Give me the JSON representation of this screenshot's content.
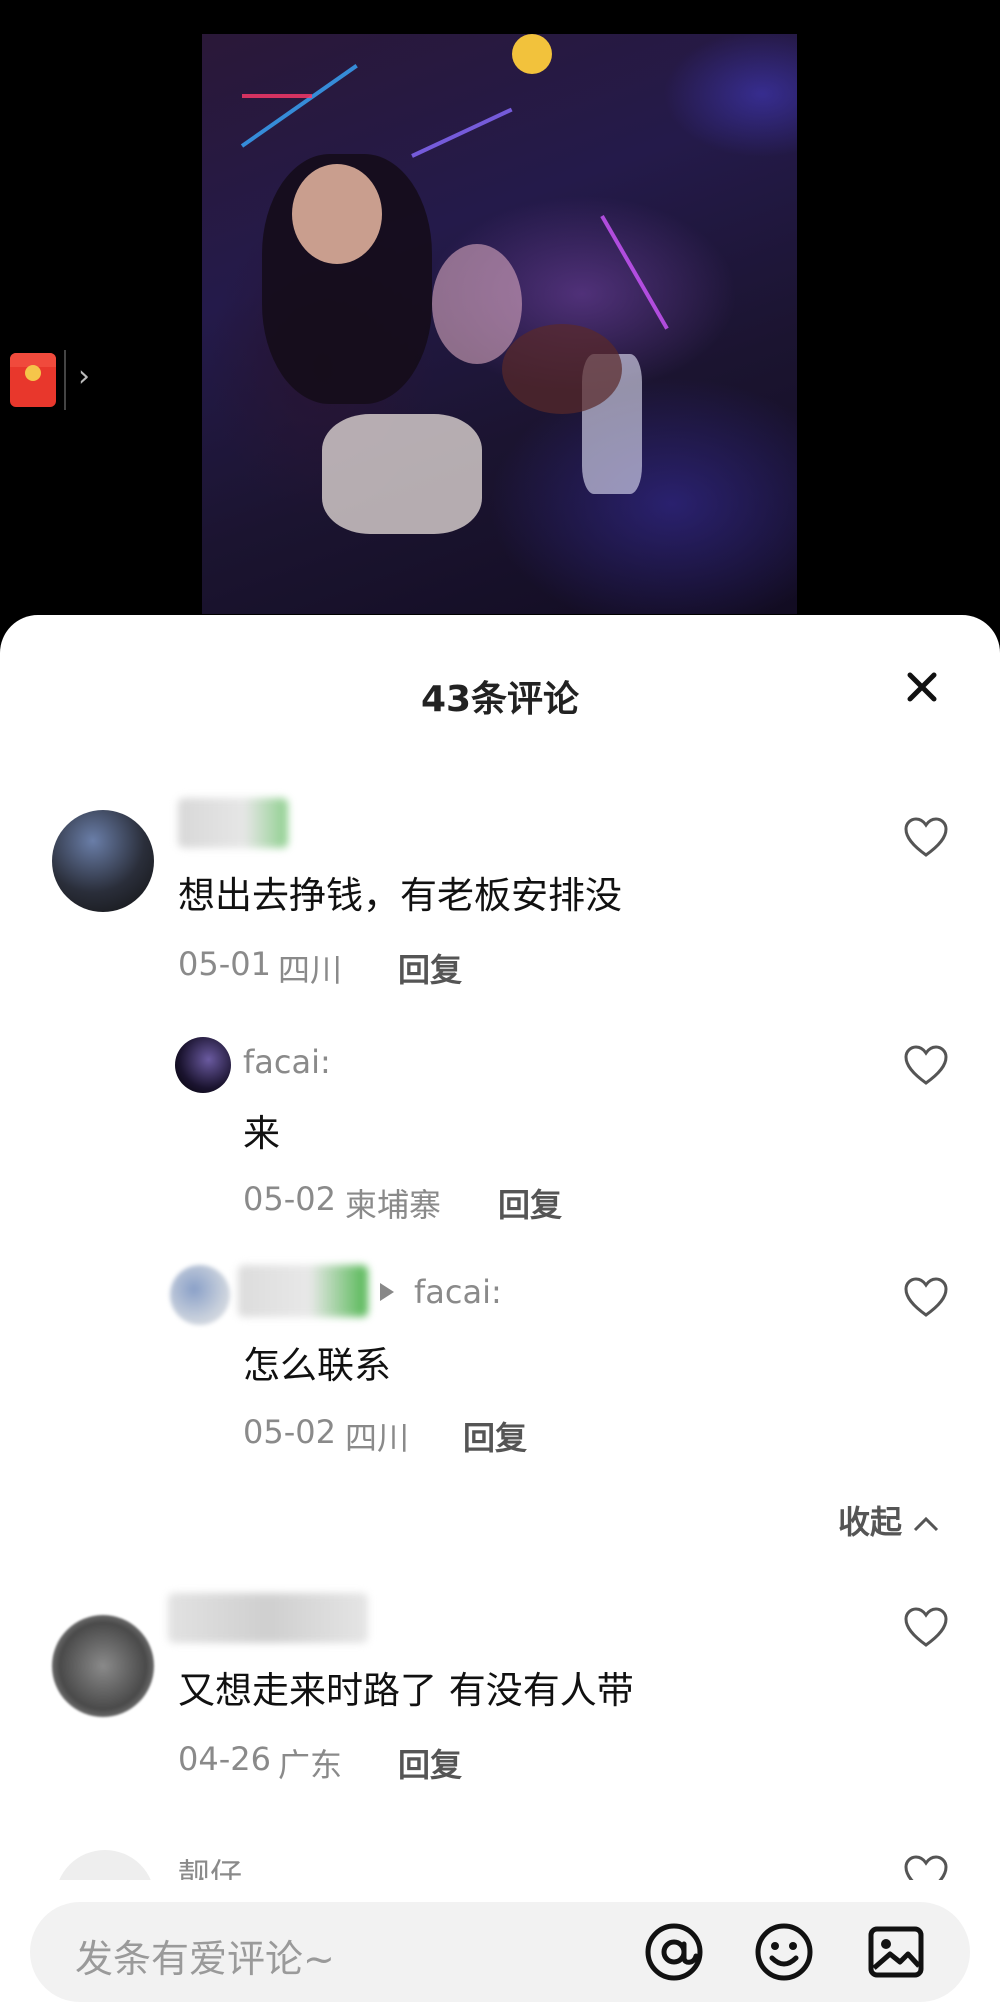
{
  "comments_header": {
    "title": "43条评论"
  },
  "comments": [
    {
      "text": "想出去挣钱，有老板安排没",
      "date": "05-01",
      "location": "四川",
      "reply_label": "回复"
    },
    {
      "user": "facai:",
      "text": "来",
      "date": "05-02",
      "location": "柬埔寨",
      "reply_label": "回复"
    },
    {
      "reply_to": "facai:",
      "text": "怎么联系",
      "date": "05-02",
      "location": "四川",
      "reply_label": "回复"
    },
    {
      "text": "又想走来时路了 有没有人带",
      "date": "04-26",
      "location": "广东",
      "reply_label": "回复"
    },
    {
      "user": "靓仔"
    }
  ],
  "collapse_label": "收起",
  "input": {
    "placeholder": "发条有爱评论~"
  },
  "icons": [
    "red-packet-icon",
    "chevron-right-icon",
    "close-icon",
    "heart-icon",
    "at-icon",
    "emoji-icon",
    "image-icon",
    "chevron-up-icon",
    "play-triangle-icon"
  ],
  "colors": {
    "sheet_bg": "#ffffff",
    "meta": "#8a8a8a",
    "text": "#111111",
    "red_packet": "#e8372c"
  }
}
